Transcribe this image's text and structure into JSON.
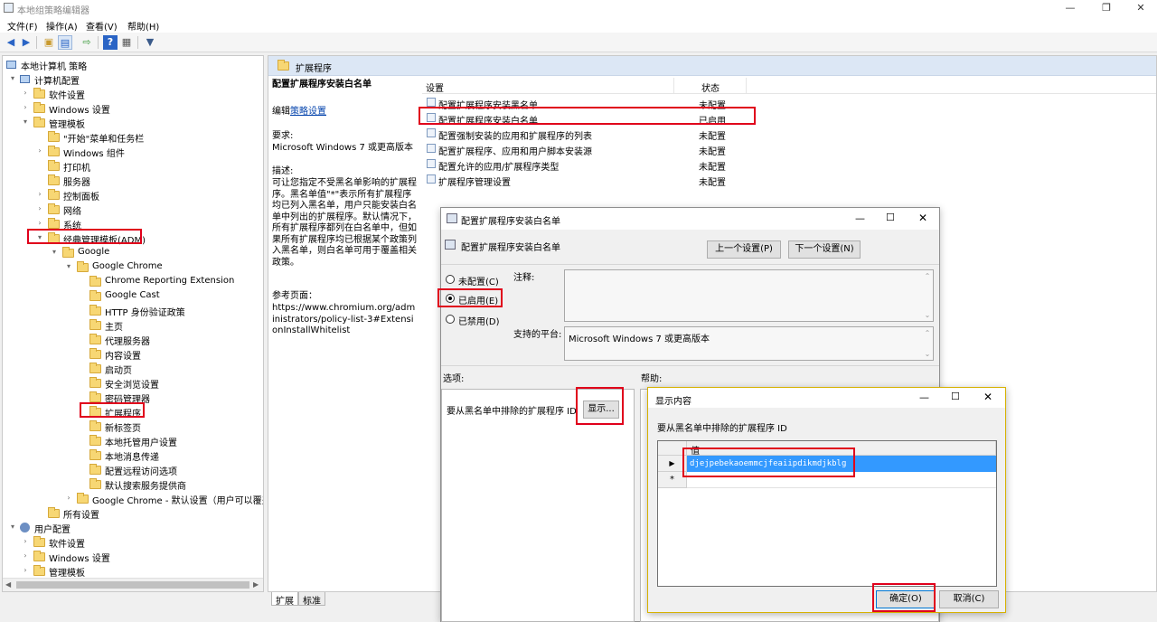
{
  "window": {
    "title": "本地组策略编辑器",
    "controls": {
      "minimize": "—",
      "maximize": "❐",
      "close": "✕"
    }
  },
  "menu": [
    "文件(F)",
    "操作(A)",
    "查看(V)",
    "帮助(H)"
  ],
  "toolbar": {
    "icons": [
      "back-icon",
      "forward-icon",
      "up-folder-icon",
      "show-hide-tree-icon",
      "export-list-icon",
      "help-icon",
      "properties-icon",
      "filter-icon"
    ]
  },
  "tree": {
    "root": "本地计算机 策略",
    "computer_config": "计算机配置",
    "software_settings": "软件设置",
    "windows_settings": "Windows 设置",
    "admin_templates": "管理模板",
    "start_menu": "\"开始\"菜单和任务栏",
    "windows_components": "Windows 组件",
    "printers": "打印机",
    "servers": "服务器",
    "control_panel": "控制面板",
    "network": "网络",
    "system": "系统",
    "classic_adm": "经典管理模板(ADM)",
    "google": "Google",
    "google_chrome": "Google Chrome",
    "chrome_reporting": "Chrome Reporting Extension",
    "google_cast": "Google Cast",
    "http_auth": "HTTP 身份验证政策",
    "homepage": "主页",
    "proxy": "代理服务器",
    "content": "内容设置",
    "startup": "启动页",
    "safe_browsing": "安全浏览设置",
    "password_mgr": "密码管理器",
    "extensions": "扩展程序",
    "new_tab": "新标签页",
    "native_host": "本地托管用户设置",
    "native_messaging": "本地消息传递",
    "remote_access": "配置远程访问选项",
    "default_search": "默认搜索服务提供商",
    "chrome_default": "Google Chrome - 默认设置（用户可以覆盖",
    "all_settings": "所有设置",
    "user_config": "用户配置",
    "user_software": "软件设置",
    "user_windows": "Windows 设置",
    "user_admin": "管理模板"
  },
  "right_header": "扩展程序",
  "description": {
    "title": "配置扩展程序安装白名单",
    "edit_prefix": "编辑",
    "edit_link": "策略设置",
    "requirements_label": "要求:",
    "requirements_value": "Microsoft Windows 7 或更高版本",
    "description_label": "描述:",
    "description_text": "可让您指定不受黑名单影响的扩展程序。黑名单值\"*\"表示所有扩展程序均已列入黑名单，用户只能安装白名单中列出的扩展程序。默认情况下，所有扩展程序都列在白名单中，但如果所有扩展程序均已根据某个政策列入黑名单，则白名单可用于覆盖相关政策。",
    "reference_label": "参考页面：",
    "reference_url": "https://www.chromium.org/administrators/policy-list-3#ExtensionInstallWhitelist"
  },
  "settings_list": {
    "col_setting": "设置",
    "col_state": "状态",
    "rows": [
      {
        "name": "配置扩展程序安装黑名单",
        "state": "未配置"
      },
      {
        "name": "配置扩展程序安装白名单",
        "state": "已启用"
      },
      {
        "name": "配置强制安装的应用和扩展程序的列表",
        "state": "未配置"
      },
      {
        "name": "配置扩展程序、应用和用户脚本安装源",
        "state": "未配置"
      },
      {
        "name": "配置允许的应用/扩展程序类型",
        "state": "未配置"
      },
      {
        "name": "扩展程序管理设置",
        "state": "未配置"
      }
    ]
  },
  "bottom_tabs": [
    "扩展",
    "标准"
  ],
  "dialog1": {
    "title": "配置扩展程序安装白名单",
    "heading": "配置扩展程序安装白名单",
    "prev_button": "上一个设置(P)",
    "next_button": "下一个设置(N)",
    "radio_not_configured": "未配置(C)",
    "radio_enabled": "已启用(E)",
    "radio_disabled": "已禁用(D)",
    "comment_label": "注释:",
    "platform_label": "支持的平台:",
    "platform_value": "Microsoft Windows 7 或更高版本",
    "options_label": "选项:",
    "help_label": "帮助:",
    "option_text": "要从黑名单中排除的扩展程序 ID",
    "show_button": "显示..."
  },
  "dialog2": {
    "title": "显示内容",
    "label": "要从黑名单中排除的扩展程序 ID",
    "col_value": "值",
    "row_value": "djejpebekaoemmcjfeaiipdikmdjkblg",
    "ok_button": "确定(O)",
    "cancel_button": "取消(C)"
  }
}
